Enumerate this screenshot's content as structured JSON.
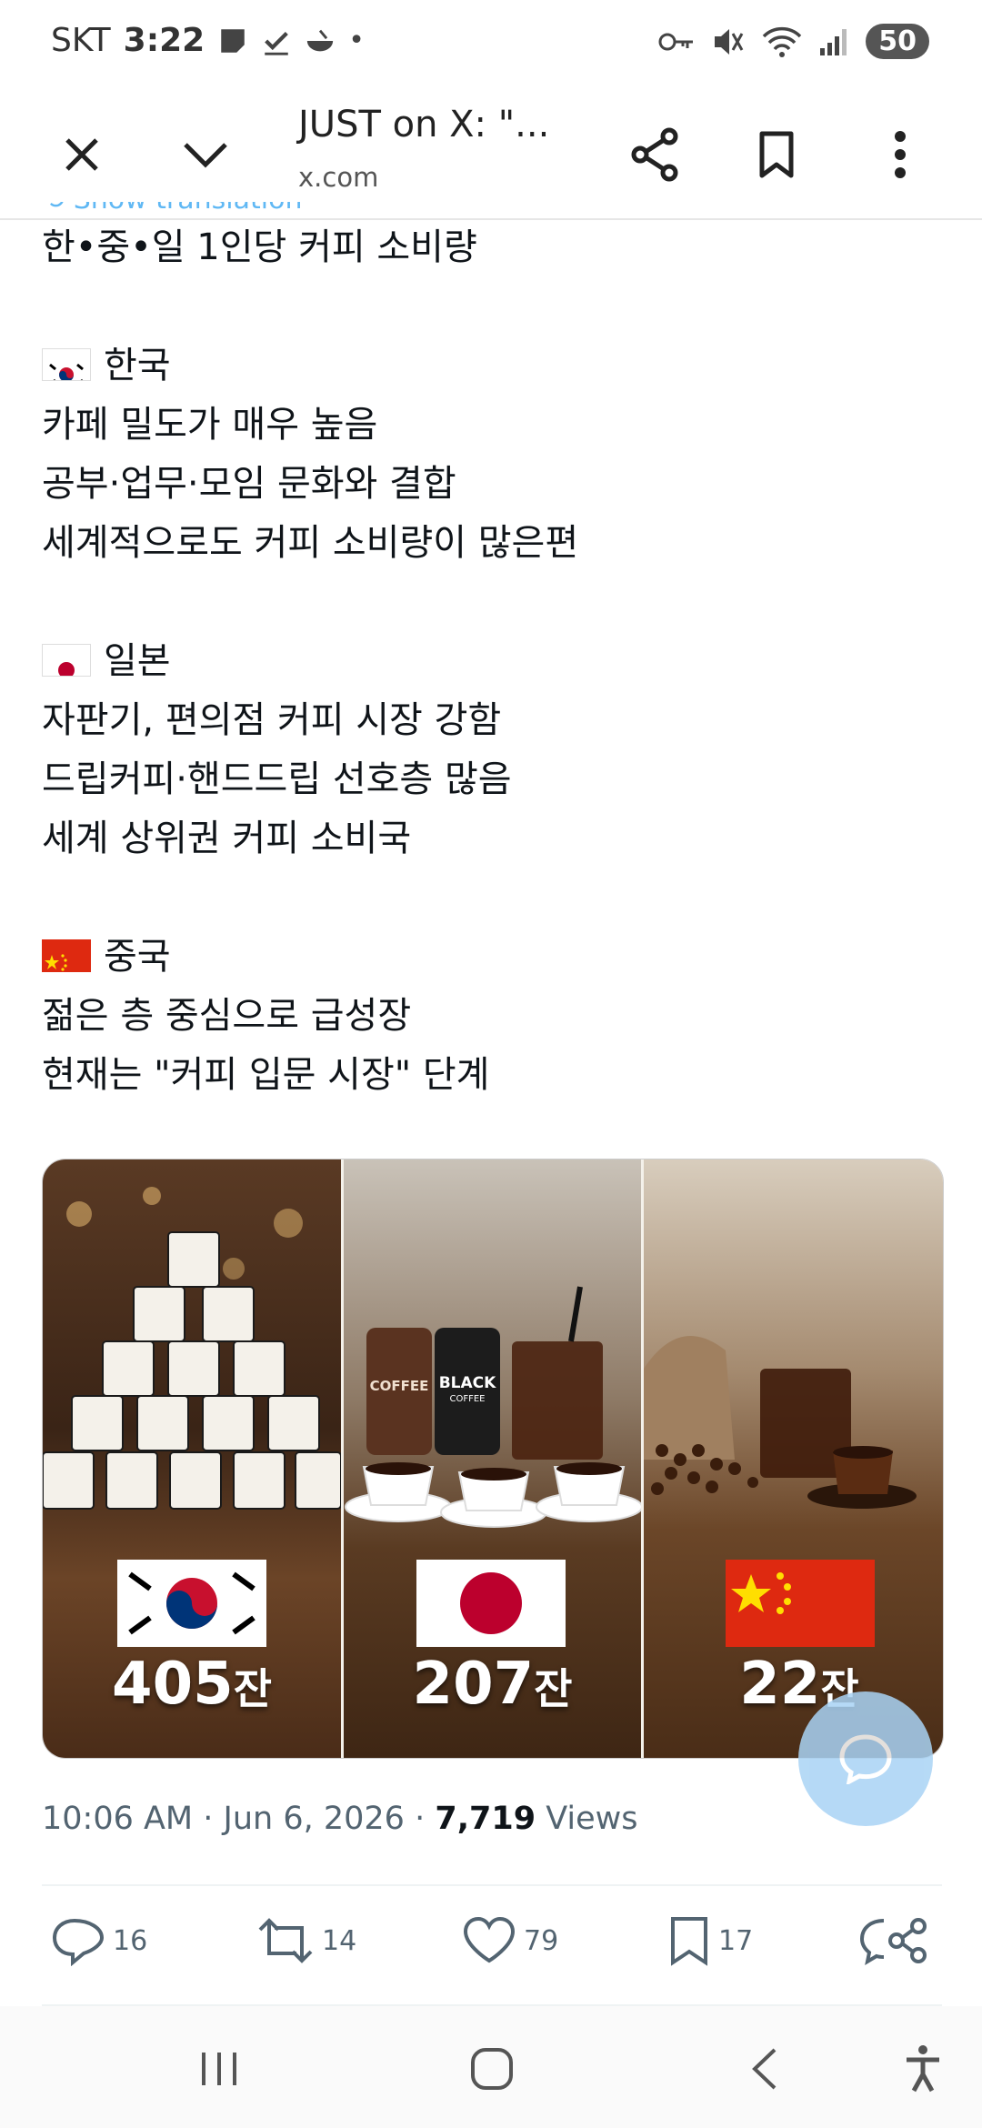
{
  "status_bar": {
    "carrier": "SKT",
    "time": "3:22",
    "battery": "50"
  },
  "toolbar": {
    "title": "JUST on X: \"...",
    "url": "x.com"
  },
  "tweet": {
    "show_translation": "Show translation",
    "heading": "한•중•일 1인당 커피 소비량",
    "korea": {
      "name": "한국",
      "lines": [
        "카페 밀도가 매우 높음",
        "공부·업무·모임 문화와 결합",
        "세계적으로도 커피 소비량이 많은편"
      ]
    },
    "japan": {
      "name": "일본",
      "lines": [
        "자판기, 편의점 커피 시장 강함",
        "드립커피·핸드드립 선호층 많음",
        "세계 상위권 커피 소비국"
      ]
    },
    "china": {
      "name": "중국",
      "lines": [
        "젊은 층 중심으로 급성장",
        "현재는 \"커피 입문 시장\" 단계"
      ]
    }
  },
  "image": {
    "korea": {
      "count": "405",
      "unit": "잔"
    },
    "japan": {
      "count": "207",
      "unit": "잔",
      "can1": "COFFEE",
      "can2": "BLACK",
      "can2_sub": "COFFEE"
    },
    "china": {
      "count": "22",
      "unit": "잔"
    }
  },
  "meta": {
    "time": "10:06 AM",
    "date": "Jun 6, 2026",
    "views_count": "7,719",
    "views_label": "Views"
  },
  "actions": {
    "replies": "16",
    "reposts": "14",
    "likes": "79",
    "bookmarks": "17"
  }
}
